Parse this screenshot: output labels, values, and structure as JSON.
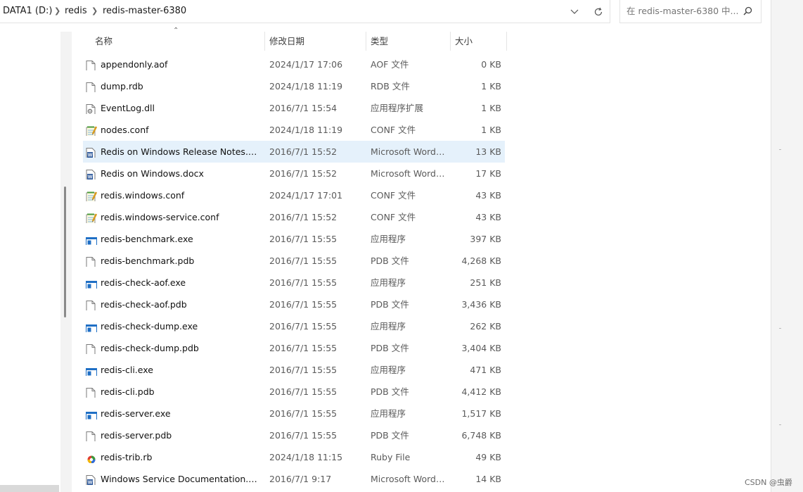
{
  "address_bar": {
    "crumbs": [
      "DATA1 (D:)",
      "redis",
      "redis-master-6380"
    ]
  },
  "search": {
    "placeholder": "在 redis-master-6380 中..."
  },
  "columns": {
    "name": "名称",
    "date": "修改日期",
    "type": "类型",
    "size": "大小"
  },
  "files": [
    {
      "name": "appendonly.aof",
      "date": "2024/1/17 17:06",
      "type": "AOF 文件",
      "size": "0 KB",
      "icon": "file-icon"
    },
    {
      "name": "dump.rdb",
      "date": "2024/1/18 11:19",
      "type": "RDB 文件",
      "size": "1 KB",
      "icon": "file-icon"
    },
    {
      "name": "EventLog.dll",
      "date": "2016/7/1 15:54",
      "type": "应用程序扩展",
      "size": "1 KB",
      "icon": "dll-file-icon"
    },
    {
      "name": "nodes.conf",
      "date": "2024/1/18 11:19",
      "type": "CONF 文件",
      "size": "1 KB",
      "icon": "notepad-file-icon"
    },
    {
      "name": "Redis on Windows Release Notes.do...",
      "date": "2016/7/1 15:52",
      "type": "Microsoft Word ...",
      "size": "13 KB",
      "icon": "word-document-icon",
      "selected": true
    },
    {
      "name": "Redis on Windows.docx",
      "date": "2016/7/1 15:52",
      "type": "Microsoft Word ...",
      "size": "17 KB",
      "icon": "word-document-icon"
    },
    {
      "name": "redis.windows.conf",
      "date": "2024/1/17 17:01",
      "type": "CONF 文件",
      "size": "43 KB",
      "icon": "notepad-file-icon"
    },
    {
      "name": "redis.windows-service.conf",
      "date": "2016/7/1 15:52",
      "type": "CONF 文件",
      "size": "43 KB",
      "icon": "notepad-file-icon"
    },
    {
      "name": "redis-benchmark.exe",
      "date": "2016/7/1 15:55",
      "type": "应用程序",
      "size": "397 KB",
      "icon": "exe-file-icon"
    },
    {
      "name": "redis-benchmark.pdb",
      "date": "2016/7/1 15:55",
      "type": "PDB 文件",
      "size": "4,268 KB",
      "icon": "file-icon"
    },
    {
      "name": "redis-check-aof.exe",
      "date": "2016/7/1 15:55",
      "type": "应用程序",
      "size": "251 KB",
      "icon": "exe-file-icon"
    },
    {
      "name": "redis-check-aof.pdb",
      "date": "2016/7/1 15:55",
      "type": "PDB 文件",
      "size": "3,436 KB",
      "icon": "file-icon"
    },
    {
      "name": "redis-check-dump.exe",
      "date": "2016/7/1 15:55",
      "type": "应用程序",
      "size": "262 KB",
      "icon": "exe-file-icon"
    },
    {
      "name": "redis-check-dump.pdb",
      "date": "2016/7/1 15:55",
      "type": "PDB 文件",
      "size": "3,404 KB",
      "icon": "file-icon"
    },
    {
      "name": "redis-cli.exe",
      "date": "2016/7/1 15:55",
      "type": "应用程序",
      "size": "471 KB",
      "icon": "exe-file-icon"
    },
    {
      "name": "redis-cli.pdb",
      "date": "2016/7/1 15:55",
      "type": "PDB 文件",
      "size": "4,412 KB",
      "icon": "file-icon"
    },
    {
      "name": "redis-server.exe",
      "date": "2016/7/1 15:55",
      "type": "应用程序",
      "size": "1,517 KB",
      "icon": "exe-file-icon"
    },
    {
      "name": "redis-server.pdb",
      "date": "2016/7/1 15:55",
      "type": "PDB 文件",
      "size": "6,748 KB",
      "icon": "file-icon"
    },
    {
      "name": "redis-trib.rb",
      "date": "2024/1/18 11:15",
      "type": "Ruby File",
      "size": "49 KB",
      "icon": "ruby-file-icon"
    },
    {
      "name": "Windows Service Documentation.docx",
      "date": "2016/7/1 9:17",
      "type": "Microsoft Word ...",
      "size": "14 KB",
      "icon": "word-document-icon"
    }
  ],
  "watermark": "CSDN @虫爵",
  "colors": {
    "selected_row": "#e5f1fb",
    "word_blue": "#2b579a",
    "exe_blue": "#1f6fc5"
  }
}
